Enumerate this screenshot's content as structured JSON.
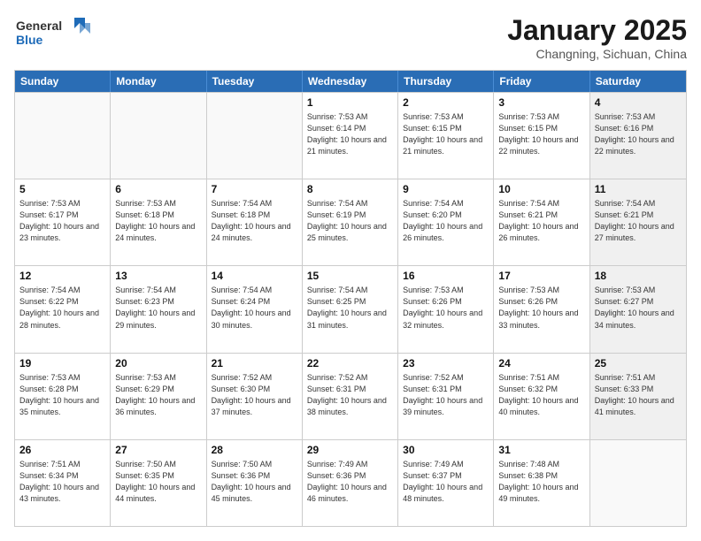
{
  "logo": {
    "line1": "General",
    "line2": "Blue"
  },
  "header": {
    "title": "January 2025",
    "subtitle": "Changning, Sichuan, China"
  },
  "weekdays": [
    "Sunday",
    "Monday",
    "Tuesday",
    "Wednesday",
    "Thursday",
    "Friday",
    "Saturday"
  ],
  "weeks": [
    [
      {
        "day": "",
        "info": "",
        "empty": true
      },
      {
        "day": "",
        "info": "",
        "empty": true
      },
      {
        "day": "",
        "info": "",
        "empty": true
      },
      {
        "day": "1",
        "info": "Sunrise: 7:53 AM\nSunset: 6:14 PM\nDaylight: 10 hours and 21 minutes."
      },
      {
        "day": "2",
        "info": "Sunrise: 7:53 AM\nSunset: 6:15 PM\nDaylight: 10 hours and 21 minutes."
      },
      {
        "day": "3",
        "info": "Sunrise: 7:53 AM\nSunset: 6:15 PM\nDaylight: 10 hours and 22 minutes."
      },
      {
        "day": "4",
        "info": "Sunrise: 7:53 AM\nSunset: 6:16 PM\nDaylight: 10 hours and 22 minutes.",
        "shaded": true
      }
    ],
    [
      {
        "day": "5",
        "info": "Sunrise: 7:53 AM\nSunset: 6:17 PM\nDaylight: 10 hours and 23 minutes."
      },
      {
        "day": "6",
        "info": "Sunrise: 7:53 AM\nSunset: 6:18 PM\nDaylight: 10 hours and 24 minutes."
      },
      {
        "day": "7",
        "info": "Sunrise: 7:54 AM\nSunset: 6:18 PM\nDaylight: 10 hours and 24 minutes."
      },
      {
        "day": "8",
        "info": "Sunrise: 7:54 AM\nSunset: 6:19 PM\nDaylight: 10 hours and 25 minutes."
      },
      {
        "day": "9",
        "info": "Sunrise: 7:54 AM\nSunset: 6:20 PM\nDaylight: 10 hours and 26 minutes."
      },
      {
        "day": "10",
        "info": "Sunrise: 7:54 AM\nSunset: 6:21 PM\nDaylight: 10 hours and 26 minutes."
      },
      {
        "day": "11",
        "info": "Sunrise: 7:54 AM\nSunset: 6:21 PM\nDaylight: 10 hours and 27 minutes.",
        "shaded": true
      }
    ],
    [
      {
        "day": "12",
        "info": "Sunrise: 7:54 AM\nSunset: 6:22 PM\nDaylight: 10 hours and 28 minutes."
      },
      {
        "day": "13",
        "info": "Sunrise: 7:54 AM\nSunset: 6:23 PM\nDaylight: 10 hours and 29 minutes."
      },
      {
        "day": "14",
        "info": "Sunrise: 7:54 AM\nSunset: 6:24 PM\nDaylight: 10 hours and 30 minutes."
      },
      {
        "day": "15",
        "info": "Sunrise: 7:54 AM\nSunset: 6:25 PM\nDaylight: 10 hours and 31 minutes."
      },
      {
        "day": "16",
        "info": "Sunrise: 7:53 AM\nSunset: 6:26 PM\nDaylight: 10 hours and 32 minutes."
      },
      {
        "day": "17",
        "info": "Sunrise: 7:53 AM\nSunset: 6:26 PM\nDaylight: 10 hours and 33 minutes."
      },
      {
        "day": "18",
        "info": "Sunrise: 7:53 AM\nSunset: 6:27 PM\nDaylight: 10 hours and 34 minutes.",
        "shaded": true
      }
    ],
    [
      {
        "day": "19",
        "info": "Sunrise: 7:53 AM\nSunset: 6:28 PM\nDaylight: 10 hours and 35 minutes."
      },
      {
        "day": "20",
        "info": "Sunrise: 7:53 AM\nSunset: 6:29 PM\nDaylight: 10 hours and 36 minutes."
      },
      {
        "day": "21",
        "info": "Sunrise: 7:52 AM\nSunset: 6:30 PM\nDaylight: 10 hours and 37 minutes."
      },
      {
        "day": "22",
        "info": "Sunrise: 7:52 AM\nSunset: 6:31 PM\nDaylight: 10 hours and 38 minutes."
      },
      {
        "day": "23",
        "info": "Sunrise: 7:52 AM\nSunset: 6:31 PM\nDaylight: 10 hours and 39 minutes."
      },
      {
        "day": "24",
        "info": "Sunrise: 7:51 AM\nSunset: 6:32 PM\nDaylight: 10 hours and 40 minutes."
      },
      {
        "day": "25",
        "info": "Sunrise: 7:51 AM\nSunset: 6:33 PM\nDaylight: 10 hours and 41 minutes.",
        "shaded": true
      }
    ],
    [
      {
        "day": "26",
        "info": "Sunrise: 7:51 AM\nSunset: 6:34 PM\nDaylight: 10 hours and 43 minutes."
      },
      {
        "day": "27",
        "info": "Sunrise: 7:50 AM\nSunset: 6:35 PM\nDaylight: 10 hours and 44 minutes."
      },
      {
        "day": "28",
        "info": "Sunrise: 7:50 AM\nSunset: 6:36 PM\nDaylight: 10 hours and 45 minutes."
      },
      {
        "day": "29",
        "info": "Sunrise: 7:49 AM\nSunset: 6:36 PM\nDaylight: 10 hours and 46 minutes."
      },
      {
        "day": "30",
        "info": "Sunrise: 7:49 AM\nSunset: 6:37 PM\nDaylight: 10 hours and 48 minutes."
      },
      {
        "day": "31",
        "info": "Sunrise: 7:48 AM\nSunset: 6:38 PM\nDaylight: 10 hours and 49 minutes."
      },
      {
        "day": "",
        "info": "",
        "empty": true,
        "shaded": true
      }
    ]
  ]
}
